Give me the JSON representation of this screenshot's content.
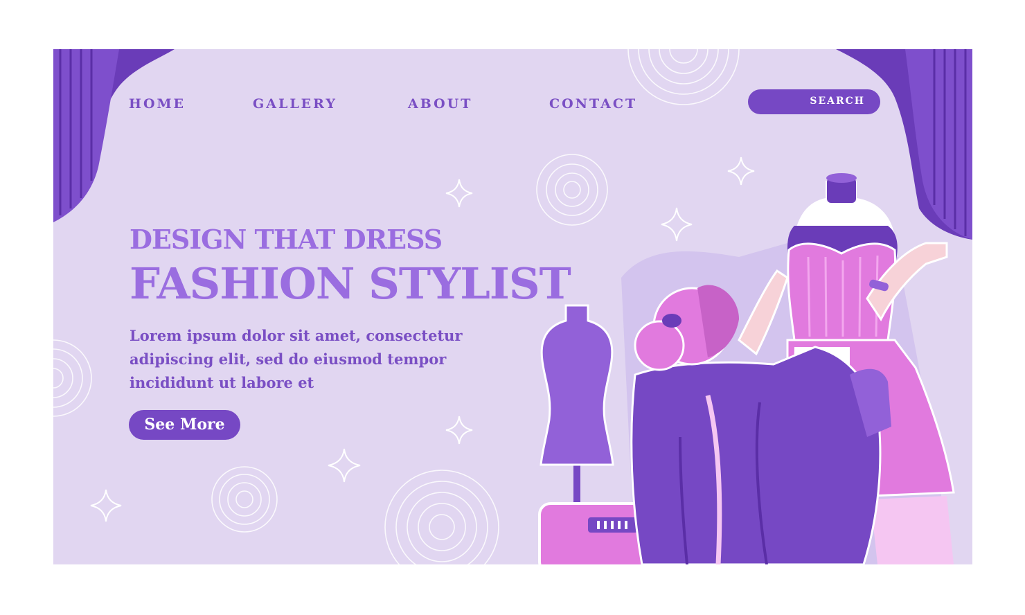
{
  "nav": {
    "items": [
      {
        "label": "HOME"
      },
      {
        "label": "GALLERY"
      },
      {
        "label": "ABOUT"
      },
      {
        "label": "CONTACT"
      }
    ],
    "search_label": "SEARCH"
  },
  "hero": {
    "subtitle": "DESIGN THAT DRESS",
    "title": "FASHION STYLIST",
    "body": "Lorem ipsum dolor sit amet, consectetur adipiscing elit, sed do eiusmod tempor incididunt ut labore et",
    "cta_label": "See More"
  },
  "colors": {
    "background": "#e1d6f1",
    "accent": "#7648c4",
    "heading": "#9a6de0",
    "pink": "#e97ae0"
  },
  "icons": [
    "curtain-left",
    "curtain-right",
    "sparkle-icon",
    "concentric-circle",
    "mannequin",
    "sewing-machine",
    "stylist-illustration"
  ]
}
